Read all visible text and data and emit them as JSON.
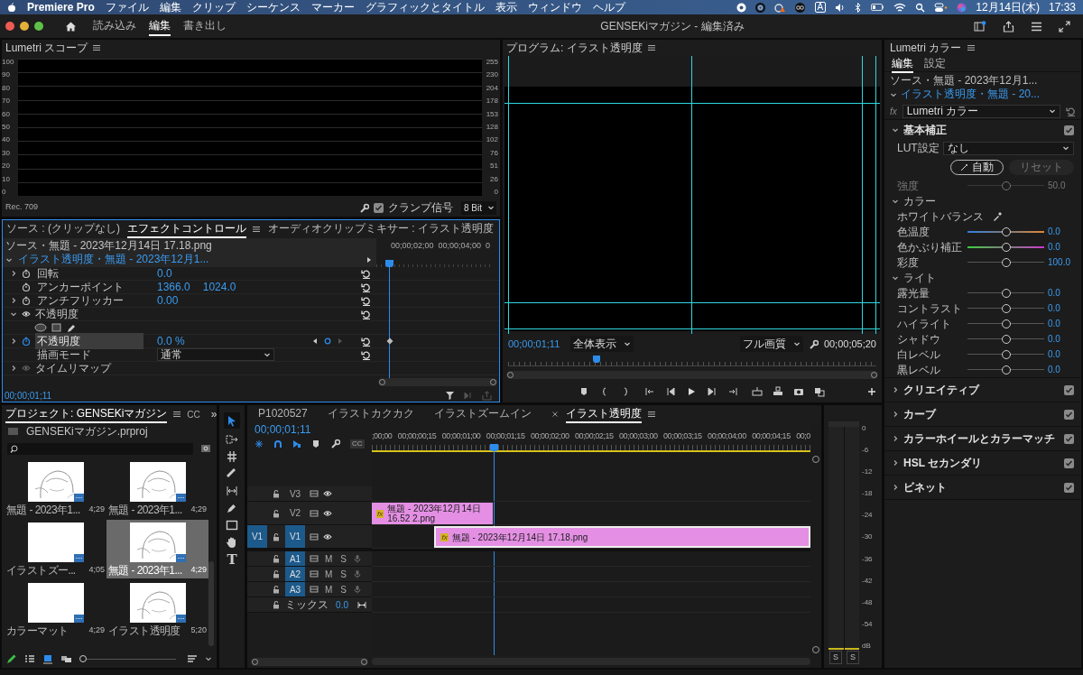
{
  "menu_bar": {
    "app": "Premiere Pro",
    "menus": [
      "ファイル",
      "編集",
      "クリップ",
      "シーケンス",
      "マーカー",
      "グラフィックとタイトル",
      "表示",
      "ウィンドウ",
      "ヘルプ"
    ],
    "input_source": "A",
    "date": "12月14日(木)",
    "time": "17:33"
  },
  "header": {
    "workspaces": [
      {
        "label": "読み込み",
        "selected": false
      },
      {
        "label": "編集",
        "selected": true
      },
      {
        "label": "書き出し",
        "selected": false
      }
    ],
    "title": "GENSEKiマガジン - 編集済み"
  },
  "scope": {
    "title": "Lumetri スコープ",
    "left_scale": [
      "100",
      "90",
      "80",
      "70",
      "60",
      "50",
      "40",
      "30",
      "20",
      "10",
      "0"
    ],
    "right_scale": [
      "255",
      "230",
      "204",
      "178",
      "153",
      "128",
      "102",
      "76",
      "51",
      "26",
      "0"
    ],
    "standard": "Rec. 709",
    "clamp": {
      "label": "クランプ信号",
      "checked": true
    },
    "bit_depth": "8 Bit"
  },
  "effect_controls": {
    "tabs": [
      {
        "label": "ソース : (クリップなし)",
        "selected": false
      },
      {
        "label": "エフェクトコントロール",
        "selected": true
      },
      {
        "label": "オーディオクリップミキサー : イラスト透明度",
        "selected": false
      }
    ],
    "source": "ソース・無題 - 2023年12月14日 17.18.png",
    "clip": "イラスト透明度・無題 - 2023年12月1...",
    "ruler": [
      "00;00;02;00",
      "00;00;04;00",
      "0"
    ],
    "playhead": {
      "level": 0.11
    },
    "rows": [
      {
        "kind": "param",
        "name": "回転",
        "values": [
          "0.0"
        ],
        "expandable": true,
        "animated": false,
        "selected": false
      },
      {
        "kind": "param",
        "name": "アンカーポイント",
        "values": [
          "1366.0",
          "1024.0"
        ],
        "expandable": false,
        "animated": false,
        "selected": false
      },
      {
        "kind": "param",
        "name": "アンチフリッカー",
        "values": [
          "0.00"
        ],
        "expandable": true,
        "animated": false,
        "selected": false
      },
      {
        "kind": "section",
        "name": "不透明度",
        "expanded": true,
        "selected": false
      },
      {
        "kind": "masks",
        "selected": false
      },
      {
        "kind": "param",
        "name": "不透明度",
        "values": [
          "0.0 %"
        ],
        "expandable": true,
        "animated": true,
        "selected": true
      },
      {
        "kind": "select",
        "name": "描画モード",
        "value": "通常",
        "selected": false
      },
      {
        "kind": "section",
        "name": "タイムリマップ",
        "expanded": false,
        "selected": false
      }
    ],
    "timecode": "00;00;01;11"
  },
  "program": {
    "title": "プログラム: イラスト透明度",
    "timecode": "00;00;01;11",
    "zoom": "全体表示",
    "quality": "フル画質",
    "duration": "00;00;05;20",
    "scrubber": {
      "level": 0.24
    }
  },
  "project": {
    "title": "プロジェクト: GENSEKiマガジン",
    "other_tab": "CC",
    "overflow": "»",
    "file": "GENSEKiマガジン.prproj",
    "zoom_slider": {
      "level": 0
    },
    "items": [
      {
        "name": "無題 - 2023年1...",
        "duration": "4;29",
        "kind": "picture",
        "selected": false
      },
      {
        "name": "無題 - 2023年1...",
        "duration": "4;29",
        "kind": "picture",
        "selected": false
      },
      {
        "name": "イラストズー...",
        "duration": "4;05",
        "kind": "blank",
        "selected": false
      },
      {
        "name": "無題 - 2023年1...",
        "duration": "4;29",
        "kind": "picture",
        "selected": true
      },
      {
        "name": "カラーマット",
        "duration": "4;29",
        "kind": "blank",
        "selected": false
      },
      {
        "name": "イラスト透明度",
        "duration": "5;20",
        "kind": "picture",
        "selected": false
      }
    ]
  },
  "tools": {
    "type_tool": "T"
  },
  "timeline": {
    "tabs": [
      {
        "label": "P1020527",
        "selected": false
      },
      {
        "label": "イラストカクカク",
        "selected": false
      },
      {
        "label": "イラストズームイン",
        "selected": false
      },
      {
        "label": "イラスト透明度",
        "selected": true
      }
    ],
    "timecode": "00;00;01;11",
    "captions": "CC",
    "ruler": [
      ";00;00",
      "00;00;00;15",
      "00;00;01;00",
      "00;00;01;15",
      "00;00;02;00",
      "00;00;02;15",
      "00;00;03;00",
      "00;00;03;15",
      "00;00;04;00",
      "00;00;04;15",
      "00;0"
    ],
    "playhead": {
      "level": 0.277
    },
    "tracks": [
      {
        "kind": "video",
        "name": "V3",
        "targeted": false
      },
      {
        "kind": "video",
        "name": "V2",
        "targeted": false,
        "clips": [
          {
            "badge": "fx",
            "name": "無題 - 2023年12月14日 16.52 2.png",
            "selected": false
          }
        ]
      },
      {
        "kind": "video",
        "name": "V1",
        "targeted": true,
        "source_patch": "V1",
        "clips": [
          {
            "badge": "fx",
            "name": "無題 - 2023年12月14日 17.18.png",
            "selected": true
          }
        ]
      },
      {
        "kind": "audio",
        "name": "A1",
        "targeted": true,
        "mute": "M",
        "solo": "S"
      },
      {
        "kind": "audio",
        "name": "A2",
        "targeted": true,
        "mute": "M",
        "solo": "S"
      },
      {
        "kind": "audio",
        "name": "A3",
        "targeted": true,
        "mute": "M",
        "solo": "S"
      }
    ],
    "mix": {
      "label": "ミックス",
      "value": "0.0"
    }
  },
  "meter": {
    "scale": [
      "0",
      "-6",
      "-12",
      "-18",
      "-24",
      "-30",
      "-36",
      "-42",
      "-48",
      "-54",
      "dB"
    ],
    "solo_buttons": [
      "S",
      "S"
    ]
  },
  "lumetri": {
    "title": "Lumetri カラー",
    "tabs": [
      {
        "label": "編集",
        "selected": true
      },
      {
        "label": "設定",
        "selected": false
      }
    ],
    "source": "ソース・無題 - 2023年12月1...",
    "clip": "イラスト透明度・無題 - 20...",
    "fx": "fx",
    "effect": "Lumetri カラー",
    "basic": {
      "title": "基本補正",
      "expanded": true,
      "checked": true,
      "lut_label": "LUT設定",
      "lut": "なし",
      "auto": "自動",
      "reset": {
        "label": "リセット",
        "disabled": true
      },
      "intensity": {
        "label": "強度",
        "value": "50.0",
        "level": 0.5,
        "kind": "plain",
        "disabled": true
      },
      "groups": [
        {
          "title": "カラー",
          "expanded": true,
          "white_balance": "ホワイトバランス",
          "sliders": [
            {
              "label": "色温度",
              "value": "0.0",
              "level": 0.5,
              "kind": "temperature",
              "disabled": false
            },
            {
              "label": "色かぶり補正",
              "value": "0.0",
              "level": 0.5,
              "kind": "tint",
              "disabled": false
            },
            {
              "label": "彩度",
              "value": "100.0",
              "level": 0.5,
              "kind": "plain",
              "disabled": false
            }
          ]
        },
        {
          "title": "ライト",
          "expanded": true,
          "sliders": [
            {
              "label": "露光量",
              "value": "0.0",
              "level": 0.5,
              "kind": "plain",
              "disabled": false
            },
            {
              "label": "コントラスト",
              "value": "0.0",
              "level": 0.5,
              "kind": "plain",
              "disabled": false
            },
            {
              "label": "ハイライト",
              "value": "0.0",
              "level": 0.5,
              "kind": "plain",
              "disabled": false
            },
            {
              "label": "シャドウ",
              "value": "0.0",
              "level": 0.5,
              "kind": "plain",
              "disabled": false
            },
            {
              "label": "白レベル",
              "value": "0.0",
              "level": 0.5,
              "kind": "plain",
              "disabled": false
            },
            {
              "label": "黒レベル",
              "value": "0.0",
              "level": 0.5,
              "kind": "plain",
              "disabled": false
            }
          ]
        }
      ]
    },
    "sections": [
      {
        "title": "クリエイティブ",
        "expanded": false,
        "checked": true
      },
      {
        "title": "カーブ",
        "expanded": false,
        "checked": true
      },
      {
        "title": "カラーホイールとカラーマッチ",
        "expanded": false,
        "checked": true
      },
      {
        "title": "HSL セカンダリ",
        "expanded": false,
        "checked": true
      },
      {
        "title": "ビネット",
        "expanded": false,
        "checked": true
      }
    ]
  }
}
